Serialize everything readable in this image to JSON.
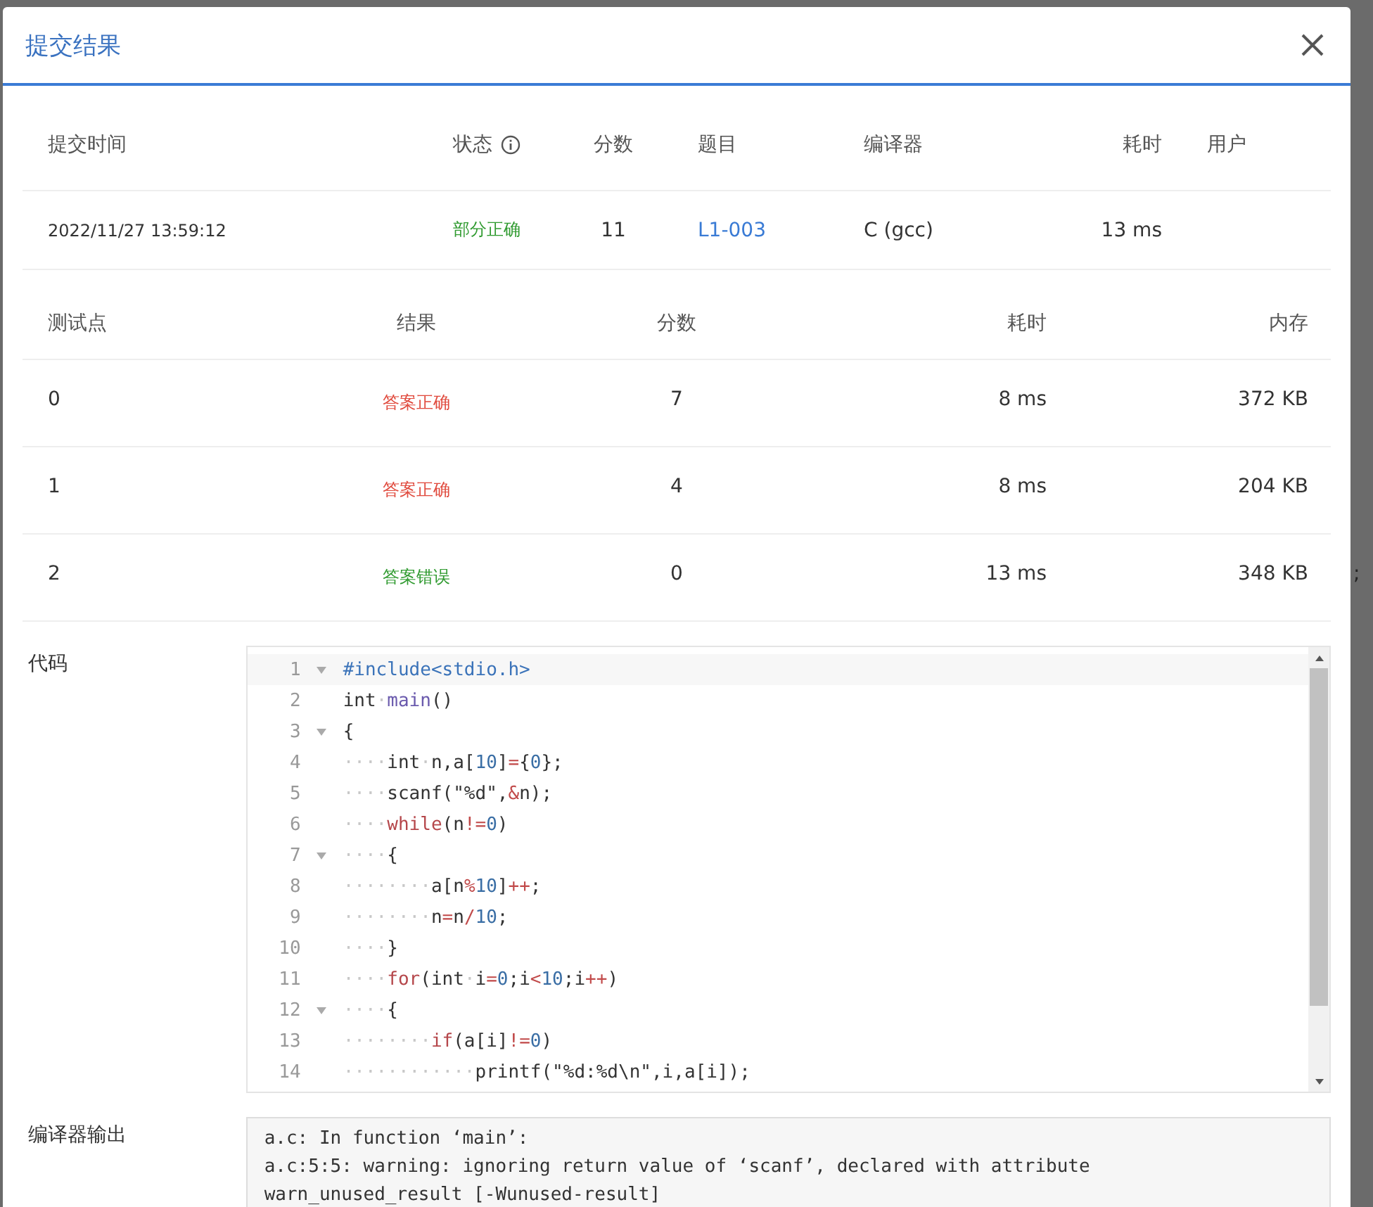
{
  "backdrop": {
    "fragment": ";"
  },
  "dialog": {
    "title": "提交结果"
  },
  "summary": {
    "columns": [
      {
        "label": "提交时间",
        "kind": "plain"
      },
      {
        "label": "状态",
        "kind": "info"
      },
      {
        "label": "分数",
        "kind": "plain"
      },
      {
        "label": "题目",
        "kind": "plain"
      },
      {
        "label": "编译器",
        "kind": "plain"
      },
      {
        "label": "耗时",
        "kind": "plain"
      },
      {
        "label": "用户",
        "kind": "plain"
      }
    ],
    "row": {
      "submitted": "2022/11/27 13:59:12",
      "status": {
        "text": "部分正确",
        "color": "#2f9a2f"
      },
      "score": "11",
      "problem": "L1-003",
      "compiler": "C (gcc)",
      "time": "13 ms"
    }
  },
  "tests": {
    "columns": [
      "测试点",
      "结果",
      "分数",
      "耗时",
      "内存"
    ],
    "rows": [
      {
        "id": "0",
        "result": {
          "text": "答案正确",
          "color": "#e0493c"
        },
        "score": "7",
        "time": "8 ms",
        "memory": "372 KB"
      },
      {
        "id": "1",
        "result": {
          "text": "答案正确",
          "color": "#e0493c"
        },
        "score": "4",
        "time": "8 ms",
        "memory": "204 KB"
      },
      {
        "id": "2",
        "result": {
          "text": "答案错误",
          "color": "#2f9a2f"
        },
        "score": "0",
        "time": "13 ms",
        "memory": "348 KB"
      }
    ]
  },
  "code": {
    "label": "代码",
    "lines": [
      {
        "no": "1",
        "fold": true,
        "tokens": [
          {
            "kind": "pp",
            "text": "#include<stdio.h>"
          }
        ]
      },
      {
        "no": "2",
        "fold": false,
        "tokens": [
          {
            "kind": "plain",
            "text": "int"
          },
          {
            "kind": "ws",
            "text": "·"
          },
          {
            "kind": "fn",
            "text": "main"
          },
          {
            "kind": "plain",
            "text": "()"
          }
        ]
      },
      {
        "no": "3",
        "fold": true,
        "tokens": [
          {
            "kind": "plain",
            "text": "{"
          }
        ]
      },
      {
        "no": "4",
        "fold": false,
        "tokens": [
          {
            "kind": "ws",
            "text": "····"
          },
          {
            "kind": "plain",
            "text": "int"
          },
          {
            "kind": "ws",
            "text": "·"
          },
          {
            "kind": "plain",
            "text": "n,a["
          },
          {
            "kind": "num",
            "text": "10"
          },
          {
            "kind": "plain",
            "text": "]"
          },
          {
            "kind": "op",
            "text": "="
          },
          {
            "kind": "plain",
            "text": "{"
          },
          {
            "kind": "num",
            "text": "0"
          },
          {
            "kind": "plain",
            "text": "};"
          }
        ]
      },
      {
        "no": "5",
        "fold": false,
        "tokens": [
          {
            "kind": "ws",
            "text": "····"
          },
          {
            "kind": "plain",
            "text": "scanf(\"%d\","
          },
          {
            "kind": "op",
            "text": "&"
          },
          {
            "kind": "plain",
            "text": "n);"
          }
        ]
      },
      {
        "no": "6",
        "fold": false,
        "tokens": [
          {
            "kind": "ws",
            "text": "····"
          },
          {
            "kind": "kw",
            "text": "while"
          },
          {
            "kind": "plain",
            "text": "(n"
          },
          {
            "kind": "op",
            "text": "!="
          },
          {
            "kind": "num",
            "text": "0"
          },
          {
            "kind": "plain",
            "text": ")"
          }
        ]
      },
      {
        "no": "7",
        "fold": true,
        "tokens": [
          {
            "kind": "ws",
            "text": "····"
          },
          {
            "kind": "plain",
            "text": "{"
          }
        ]
      },
      {
        "no": "8",
        "fold": false,
        "tokens": [
          {
            "kind": "ws",
            "text": "········"
          },
          {
            "kind": "plain",
            "text": "a[n"
          },
          {
            "kind": "op",
            "text": "%"
          },
          {
            "kind": "num",
            "text": "10"
          },
          {
            "kind": "plain",
            "text": "]"
          },
          {
            "kind": "op",
            "text": "++"
          },
          {
            "kind": "plain",
            "text": ";"
          }
        ]
      },
      {
        "no": "9",
        "fold": false,
        "tokens": [
          {
            "kind": "ws",
            "text": "········"
          },
          {
            "kind": "plain",
            "text": "n"
          },
          {
            "kind": "op",
            "text": "="
          },
          {
            "kind": "plain",
            "text": "n"
          },
          {
            "kind": "op",
            "text": "/"
          },
          {
            "kind": "num",
            "text": "10"
          },
          {
            "kind": "plain",
            "text": ";"
          }
        ]
      },
      {
        "no": "10",
        "fold": false,
        "tokens": [
          {
            "kind": "ws",
            "text": "····"
          },
          {
            "kind": "plain",
            "text": "}"
          }
        ]
      },
      {
        "no": "11",
        "fold": false,
        "tokens": [
          {
            "kind": "ws",
            "text": "····"
          },
          {
            "kind": "kw",
            "text": "for"
          },
          {
            "kind": "plain",
            "text": "(int"
          },
          {
            "kind": "ws",
            "text": "·"
          },
          {
            "kind": "plain",
            "text": "i"
          },
          {
            "kind": "op",
            "text": "="
          },
          {
            "kind": "num",
            "text": "0"
          },
          {
            "kind": "plain",
            "text": ";i"
          },
          {
            "kind": "op",
            "text": "<"
          },
          {
            "kind": "num",
            "text": "10"
          },
          {
            "kind": "plain",
            "text": ";i"
          },
          {
            "kind": "op",
            "text": "++"
          },
          {
            "kind": "plain",
            "text": ")"
          }
        ]
      },
      {
        "no": "12",
        "fold": true,
        "tokens": [
          {
            "kind": "ws",
            "text": "····"
          },
          {
            "kind": "plain",
            "text": "{"
          }
        ]
      },
      {
        "no": "13",
        "fold": false,
        "tokens": [
          {
            "kind": "ws",
            "text": "········"
          },
          {
            "kind": "kw",
            "text": "if"
          },
          {
            "kind": "plain",
            "text": "(a[i]"
          },
          {
            "kind": "op",
            "text": "!="
          },
          {
            "kind": "num",
            "text": "0"
          },
          {
            "kind": "plain",
            "text": ")"
          }
        ]
      },
      {
        "no": "14",
        "fold": false,
        "tokens": [
          {
            "kind": "ws",
            "text": "············"
          },
          {
            "kind": "plain",
            "text": "printf(\"%d:%d\\n\",i,a[i]);"
          }
        ]
      }
    ]
  },
  "compiler_output": {
    "label": "编译器输出",
    "lines": [
      "a.c: In function ‘main’:",
      "a.c:5:5: warning: ignoring return value of ‘scanf’, declared with attribute",
      "warn_unused_result [-Wunused-result]"
    ]
  }
}
